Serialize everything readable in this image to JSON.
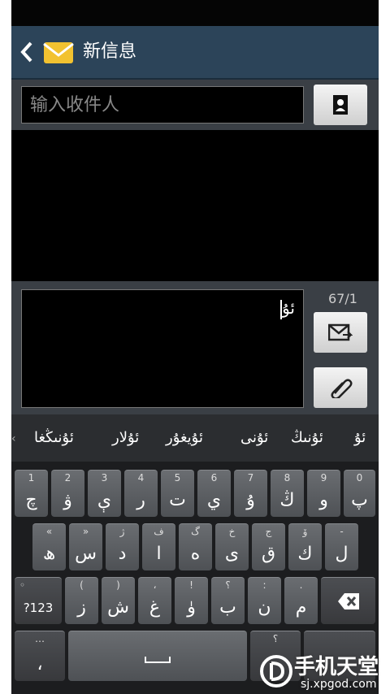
{
  "header": {
    "title": "新信息"
  },
  "recipient": {
    "placeholder": "输入收件人"
  },
  "compose": {
    "text": "ئۇ",
    "counter": "67/1"
  },
  "suggestions": [
    "ئۇ",
    "ئۇنىڭ",
    "ئۇنى",
    "ئۇيغۇر",
    "ئۇلار",
    "ئۇنىڭغا"
  ],
  "keyboard": {
    "row1": [
      {
        "main": "چ",
        "hint": "1"
      },
      {
        "main": "ۋ",
        "hint": "2"
      },
      {
        "main": "ې",
        "hint": "3"
      },
      {
        "main": "ر",
        "hint": "4"
      },
      {
        "main": "ت",
        "hint": "5"
      },
      {
        "main": "ي",
        "hint": "6"
      },
      {
        "main": "ۇ",
        "hint": "7"
      },
      {
        "main": "ڭ",
        "hint": "8"
      },
      {
        "main": "و",
        "hint": "9"
      },
      {
        "main": "پ",
        "hint": "0"
      }
    ],
    "row2": [
      {
        "main": "ھ",
        "hint": "«"
      },
      {
        "main": "س",
        "hint": "»"
      },
      {
        "main": "د",
        "hint": "ژ"
      },
      {
        "main": "ا",
        "hint": "ف"
      },
      {
        "main": "ە",
        "hint": "گ"
      },
      {
        "main": "ى",
        "hint": "خ"
      },
      {
        "main": "ق",
        "hint": "ج"
      },
      {
        "main": "ك",
        "hint": "ۆ"
      },
      {
        "main": "ل",
        "hint": "-"
      }
    ],
    "row3": [
      {
        "main": "ز",
        "hint": "("
      },
      {
        "main": "ش",
        "hint": ")"
      },
      {
        "main": "غ",
        "hint": "،"
      },
      {
        "main": "ۈ",
        "hint": "!"
      },
      {
        "main": "ب",
        "hint": "؟"
      },
      {
        "main": "ن",
        "hint": ":"
      },
      {
        "main": "م",
        "hint": "."
      }
    ],
    "sym_label": "?123",
    "sym_hint": "◦",
    "comma": "،",
    "comma_hint": "…",
    "qmark_hint": "؟"
  },
  "watermark": {
    "name": "手机天堂",
    "url": "sj.xpgod.com"
  },
  "colors": {
    "actionbar": "#2c4459",
    "panel": "#3a3f45",
    "key": "#5a5d61"
  }
}
